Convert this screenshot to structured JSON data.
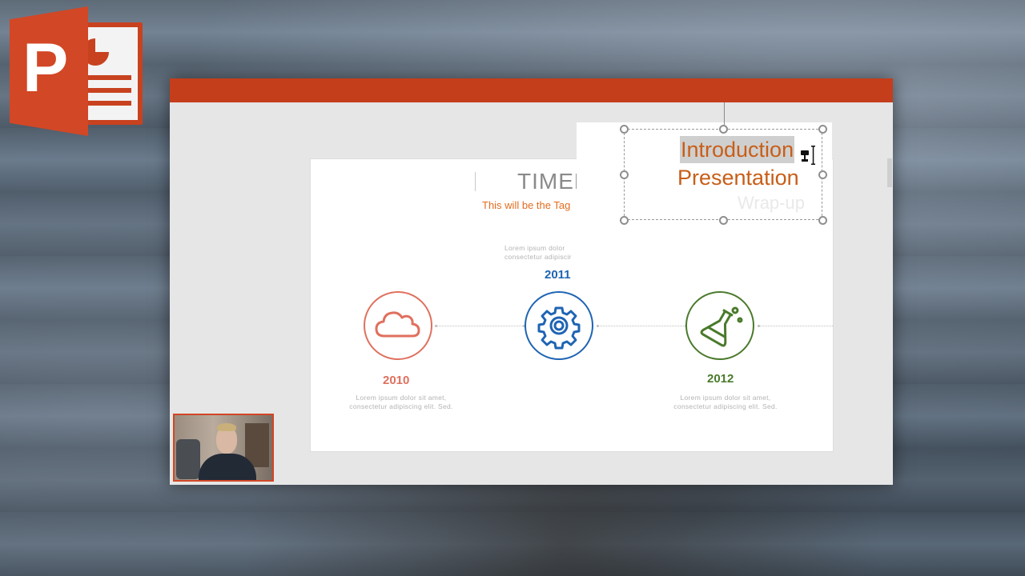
{
  "app": {
    "logo_icon": "powerpoint-logo-icon",
    "logo_letter": "P",
    "accent_color": "#c43e1c"
  },
  "slide": {
    "title": "TIMEL",
    "tagline": "This will be the Tag",
    "milestones": [
      {
        "year": "2010",
        "icon": "cloud-icon",
        "color": "#e0705e",
        "text_line1": "Lorem ipsum dolor sit amet,",
        "text_line2": "consectetur adipiscing elit. Sed."
      },
      {
        "year": "2011",
        "icon": "gear-icon",
        "color": "#1e64b4",
        "text_line1": "Lorem ipsum dolor",
        "text_line2": "consectetur adipiscir"
      },
      {
        "year": "2012",
        "icon": "flask-icon",
        "color": "#4a7a2c",
        "text_line1": "Lorem ipsum dolor sit amet,",
        "text_line2": "consectetur adipiscing elit. Sed."
      }
    ]
  },
  "textbox": {
    "line1": "Introduction",
    "line2": "Presentation",
    "line3": "Wrap-up",
    "cursor_icon": "format-painter-cursor-icon"
  },
  "webcam": {
    "label": "webcam-feed"
  }
}
